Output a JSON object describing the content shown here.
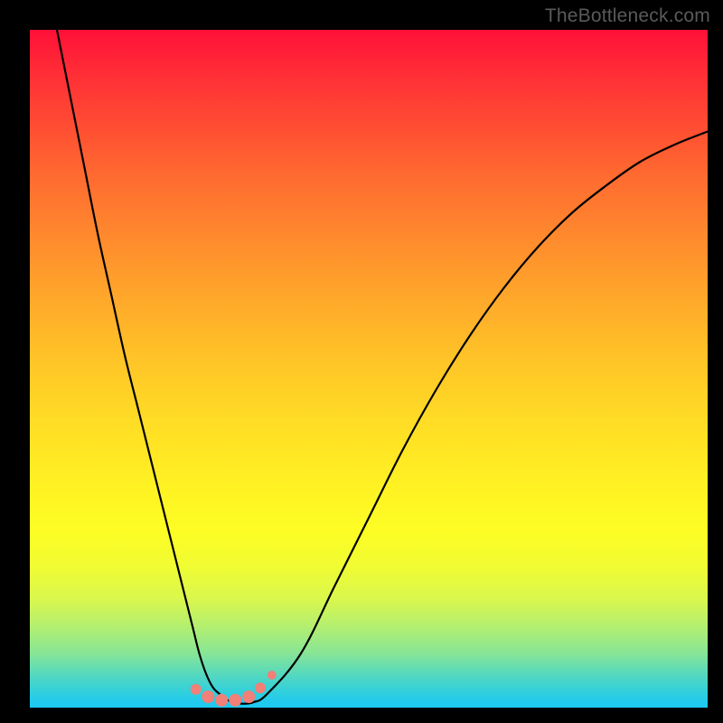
{
  "watermark": "TheBottleneck.com",
  "chart_data": {
    "type": "line",
    "title": "",
    "xlabel": "",
    "ylabel": "",
    "xlim": [
      0,
      100
    ],
    "ylim": [
      0,
      100
    ],
    "grid": false,
    "series": [
      {
        "name": "curve",
        "color": "#000000",
        "x": [
          4,
          6,
          8,
          10,
          12,
          14,
          16,
          18,
          20,
          21,
          22,
          23,
          24,
          25,
          26,
          27,
          28,
          29,
          30,
          31,
          32,
          33,
          35,
          40,
          45,
          50,
          55,
          60,
          65,
          70,
          75,
          80,
          85,
          90,
          95,
          100
        ],
        "values": [
          100,
          90,
          80,
          70,
          61,
          52,
          44,
          36,
          28,
          24,
          20,
          16,
          12,
          8,
          5,
          3,
          2,
          1.2,
          0.8,
          0.6,
          0.6,
          0.8,
          2,
          8,
          18,
          28,
          38,
          47,
          55,
          62,
          68,
          73,
          77,
          80.5,
          83,
          85
        ]
      }
    ],
    "markers": [
      {
        "x": 24.5,
        "y": 2.7,
        "r": 6,
        "color": "#f08078"
      },
      {
        "x": 26.3,
        "y": 1.6,
        "r": 7,
        "color": "#f08078"
      },
      {
        "x": 28.3,
        "y": 1.1,
        "r": 7,
        "color": "#f08078"
      },
      {
        "x": 30.3,
        "y": 1.1,
        "r": 7,
        "color": "#f08078"
      },
      {
        "x": 32.3,
        "y": 1.6,
        "r": 7,
        "color": "#f08078"
      },
      {
        "x": 34.0,
        "y": 2.9,
        "r": 6,
        "color": "#f08078"
      },
      {
        "x": 35.7,
        "y": 4.8,
        "r": 5,
        "color": "#f08078"
      }
    ]
  }
}
